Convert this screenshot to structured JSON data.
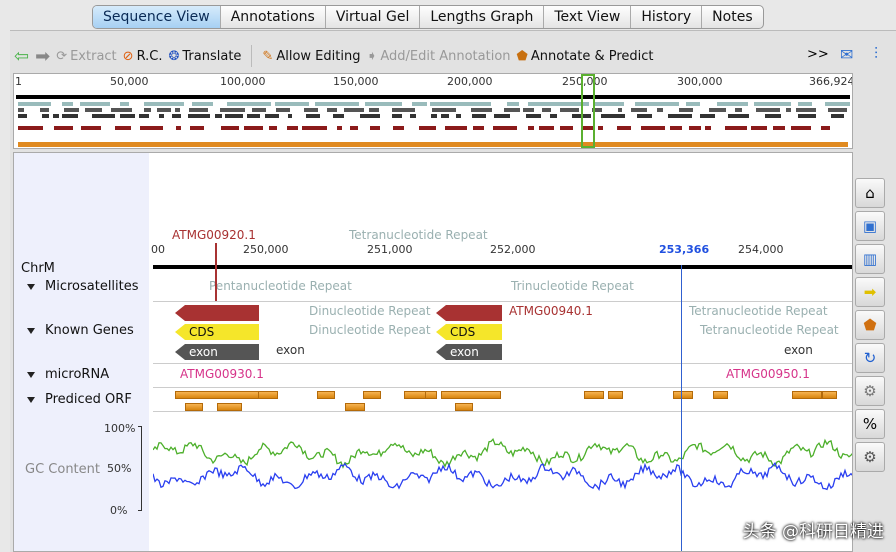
{
  "tabs": [
    "Sequence View",
    "Annotations",
    "Virtual Gel",
    "Lengths Graph",
    "Text View",
    "History",
    "Notes"
  ],
  "toolbar": {
    "extract": "Extract",
    "rc": "R.C.",
    "translate": "Translate",
    "allow_editing": "Allow Editing",
    "add_edit": "Add/Edit Annotation",
    "annotate": "Annotate & Predict",
    "more": ">>"
  },
  "overview": {
    "ticks": [
      "1",
      "50,000",
      "100,000",
      "150,000",
      "200,000",
      "250,000",
      "300,000",
      "366,924"
    ]
  },
  "tracks": {
    "chr": "ChrM",
    "microsatellites": "Microsatellites",
    "known_genes": "Known Genes",
    "microrna": "microRNA",
    "orf": "Prediced ORF",
    "gc": "GC Content",
    "gc_ticks": [
      "100%",
      "50%",
      "0%"
    ]
  },
  "ruler": {
    "ticks": [
      "00",
      "250,000",
      "251,000",
      "252,000",
      "254,000"
    ],
    "cursor": "253,366"
  },
  "features": {
    "gene1": "ATMG00920.1",
    "gene2": "ATMG00940.1",
    "cds": "CDS",
    "exon": "exon",
    "mirna1": "ATMG00930.1",
    "mirna2": "ATMG00950.1",
    "tetra": "Tetranucleotide Repeat",
    "penta": "Pentanucleotide Repeat",
    "di": "Dinucleotide Repeat",
    "tri": "Trinucleotide Repeat"
  },
  "watermark": "头条 @科研日精进",
  "colors": {
    "gene": "#a83232",
    "cds": "#f5e62a",
    "exon": "#555555",
    "mirna": "#d6348a",
    "orf": "#e8961c",
    "gc_green": "#4caf2a",
    "gc_blue": "#2a3ff0",
    "cursor": "#3060d0"
  }
}
